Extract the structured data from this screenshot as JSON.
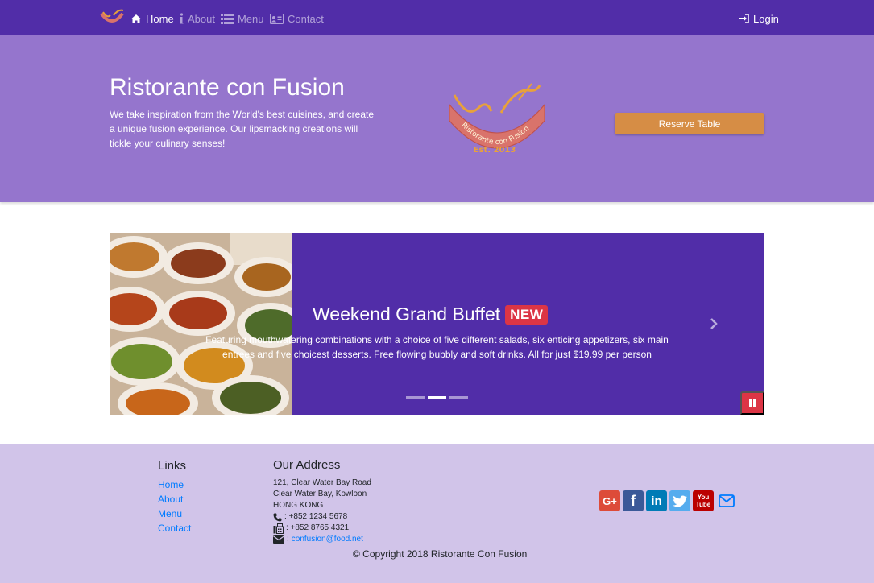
{
  "nav": {
    "items": [
      {
        "label": "Home",
        "icon": "home-icon",
        "active": true
      },
      {
        "label": "About",
        "icon": "info-icon",
        "active": false
      },
      {
        "label": "Menu",
        "icon": "list-icon",
        "active": false
      },
      {
        "label": "Contact",
        "icon": "address-card-icon",
        "active": false
      }
    ],
    "login_label": "Login"
  },
  "hero": {
    "title": "Ristorante con Fusion",
    "text": "We take inspiration from the World's best cuisines, and create a unique fusion experience. Our lipsmacking creations will tickle your culinary senses!",
    "logo_text": "Ristorante con Fusion",
    "logo_est": "Est. 2013",
    "reserve_label": "Reserve Table"
  },
  "carousel": {
    "title": "Weekend Grand Buffet",
    "badge": "NEW",
    "text": "Featuring mouthwatering combinations with a choice of five different salads, six enticing appetizers, six main entrees and five choicest desserts. Free flowing bubbly and soft drinks. All for just $19.99 per person",
    "active_slide": 2,
    "slide_count": 3
  },
  "footer": {
    "links_heading": "Links",
    "links": [
      "Home",
      "About",
      "Menu",
      "Contact"
    ],
    "address_heading": "Our Address",
    "address_lines": [
      "121, Clear Water Bay Road",
      "Clear Water Bay, Kowloon",
      "HONG KONG"
    ],
    "phone": ": +852 1234 5678",
    "fax": ": +852 8765 4321",
    "email_prefix": ":",
    "email": "confusion@food.net",
    "copyright": "© Copyright 2018 Ristorante Con Fusion",
    "socials": [
      {
        "name": "google-plus",
        "glyph": "G+",
        "color": "#dd4b39"
      },
      {
        "name": "facebook",
        "glyph": "f",
        "color": "#3b5998"
      },
      {
        "name": "linkedin",
        "glyph": "in",
        "color": "#007bb6"
      },
      {
        "name": "twitter",
        "glyph": "t",
        "color": "#55acee"
      },
      {
        "name": "youtube",
        "glyph": "You Tube",
        "color": "#bb0000"
      }
    ]
  },
  "colors": {
    "primary": "#512DA8",
    "light": "#9575CD",
    "footer": "#D1C4E9",
    "accent": "#D68D45",
    "danger": "#dc3545",
    "link": "#007bff"
  }
}
